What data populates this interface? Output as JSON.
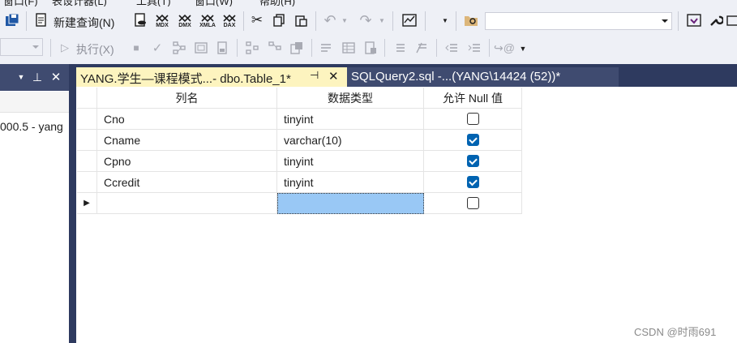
{
  "menu": {
    "items": [
      "窗口(F)",
      "表设计器(L)",
      "工具(T)",
      "窗口(W)",
      "帮助(H)"
    ]
  },
  "toolbar1": {
    "new_query_label": "新建查询(N)",
    "mdx_label": "MDX",
    "dmx_label": "DMX",
    "xmla_label": "XMLA",
    "dax_label": "DAX",
    "solution_combo_value": ""
  },
  "toolbar2": {
    "execute_label": "执行(X)"
  },
  "left_panel": {
    "pin_glyph": "⊥",
    "close_glyph": "✕",
    "server_node_text": "000.5 - yang"
  },
  "tabs": [
    {
      "label": "YANG.学生—课程模式...- dbo.Table_1*",
      "pin_glyph": "⊣",
      "close_glyph": "✕"
    },
    {
      "label": "SQLQuery2.sql -...(YANG\\14424 (52))*"
    }
  ],
  "table": {
    "headers": {
      "column_name": "列名",
      "data_type": "数据类型",
      "allow_null": "允许 Null 值"
    },
    "rows": [
      {
        "name": "Cno",
        "type": "tinyint",
        "allow_null": false
      },
      {
        "name": "Cname",
        "type": "varchar(10)",
        "allow_null": true
      },
      {
        "name": "Cpno",
        "type": "tinyint",
        "allow_null": true
      },
      {
        "name": "Ccredit",
        "type": "tinyint",
        "allow_null": true
      }
    ],
    "new_row": {
      "name": "",
      "type": "",
      "allow_null": false,
      "indicator": "▶"
    }
  },
  "watermark": "CSDN @时雨691",
  "colors": {
    "active_tab": "#fdf4bf",
    "dark_panel": "#2e3a5f",
    "checkbox_checked": "#0063b1",
    "selected_cell": "#99c8f5"
  }
}
